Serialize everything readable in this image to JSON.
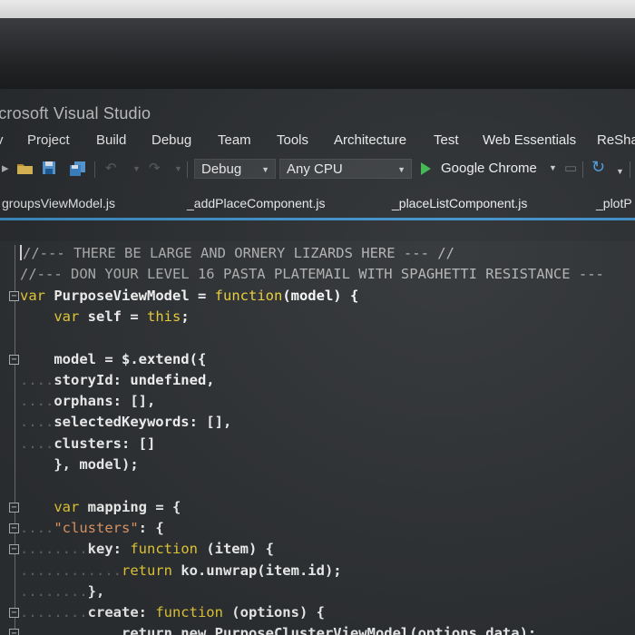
{
  "window": {
    "title": "icrosoft Visual Studio"
  },
  "menu": {
    "items": [
      "v",
      "Project",
      "Build",
      "Debug",
      "Team",
      "Tools",
      "Architecture",
      "Test",
      "Web Essentials",
      "ReSha"
    ]
  },
  "toolbar": {
    "configuration": "Debug",
    "platform": "Any CPU",
    "run_target": "Google Chrome",
    "icons": [
      "open-folder-icon",
      "save-icon",
      "save-all-icon",
      "undo-icon",
      "redo-icon",
      "play-icon",
      "refresh-icon"
    ]
  },
  "tabs": [
    "groupsViewModel.js",
    "_addPlaceComponent.js",
    "_placeListComponent.js",
    "_plotP"
  ],
  "colors": {
    "accent": "#3e92cc",
    "keyword": "#f4d83c",
    "string": "#f0a26e",
    "comment": "#b4b4b4",
    "editor_bg": "#2f3235"
  },
  "code": {
    "lines": [
      [
        {
          "t": "//--- THERE BE LARGE AND ORNERY LIZARDS HERE --- //",
          "c": "cmt"
        }
      ],
      [
        {
          "t": "//--- DON YOUR LEVEL 16 PASTA PLATEMAIL WITH SPAGHETTI RESISTANCE ---",
          "c": "cmt"
        }
      ],
      [
        {
          "t": "var",
          "c": "kw"
        },
        {
          "t": " ",
          "c": ""
        },
        {
          "t": "PurposeViewModel",
          "c": "id"
        },
        {
          "t": " = ",
          "c": "id"
        },
        {
          "t": "function",
          "c": "kw"
        },
        {
          "t": "(model) {",
          "c": "id"
        }
      ],
      [
        {
          "t": "    ",
          "c": ""
        },
        {
          "t": "var",
          "c": "kw"
        },
        {
          "t": " self = ",
          "c": "id"
        },
        {
          "t": "this",
          "c": "kw"
        },
        {
          "t": ";",
          "c": "id"
        }
      ],
      [],
      [
        {
          "t": "    model = $.extend({",
          "c": "id"
        }
      ],
      [
        {
          "t": "....",
          "c": "guide"
        },
        {
          "t": "storyId: undefined,",
          "c": "id"
        }
      ],
      [
        {
          "t": "....",
          "c": "guide"
        },
        {
          "t": "orphans: [],",
          "c": "id"
        }
      ],
      [
        {
          "t": "....",
          "c": "guide"
        },
        {
          "t": "selectedKeywords: [],",
          "c": "id"
        }
      ],
      [
        {
          "t": "....",
          "c": "guide"
        },
        {
          "t": "clusters: []",
          "c": "id"
        }
      ],
      [
        {
          "t": "    }, model);",
          "c": "id"
        }
      ],
      [],
      [
        {
          "t": "    ",
          "c": ""
        },
        {
          "t": "var",
          "c": "kw"
        },
        {
          "t": " mapping = {",
          "c": "id"
        }
      ],
      [
        {
          "t": "....",
          "c": "guide"
        },
        {
          "t": "\"clusters\"",
          "c": "str"
        },
        {
          "t": ": {",
          "c": "id"
        }
      ],
      [
        {
          "t": "........",
          "c": "guide"
        },
        {
          "t": "key: ",
          "c": "id"
        },
        {
          "t": "function",
          "c": "kw"
        },
        {
          "t": " (item) {",
          "c": "id"
        }
      ],
      [
        {
          "t": "............",
          "c": "guide"
        },
        {
          "t": "return",
          "c": "kw"
        },
        {
          "t": " ko.unwrap(item.id);",
          "c": "id"
        }
      ],
      [
        {
          "t": "........",
          "c": "guide"
        },
        {
          "t": "},",
          "c": "id"
        }
      ],
      [
        {
          "t": "........",
          "c": "guide"
        },
        {
          "t": "create: ",
          "c": "id"
        },
        {
          "t": "function",
          "c": "kw"
        },
        {
          "t": " (options) {",
          "c": "id"
        }
      ],
      [
        {
          "t": "............",
          "c": "guide"
        },
        {
          "t": "return new PurposeClusterViewModel(options.data);",
          "c": "id"
        }
      ]
    ]
  }
}
